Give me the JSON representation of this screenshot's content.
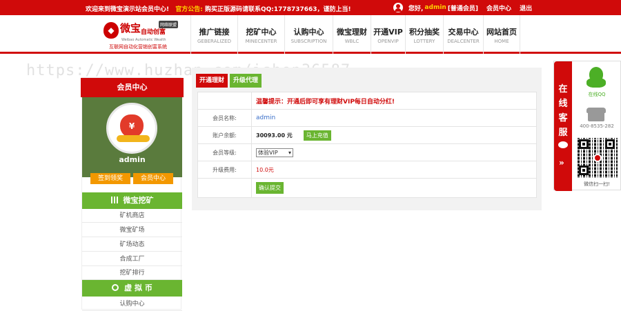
{
  "topbar": {
    "welcome": "欢迎来到微宝演示站会员中心!",
    "notice_label": "官方公告:",
    "notice_text": "购买正版源码请联系QQ:1778737663，谨防上当!",
    "greeting": "您好,",
    "username": "admin",
    "level": "[普通会员]",
    "member_center": "会员中心",
    "logout": "退出"
  },
  "logo": {
    "brand": "微宝",
    "brand_sub": "自动创富",
    "tag": "网络联盟",
    "english": "Weibao Automatic Wealth",
    "slogan": "互联网自动化营销创富系统"
  },
  "nav": [
    {
      "cn": "推广链接",
      "en": "GEBERALIZED"
    },
    {
      "cn": "挖矿中心",
      "en": "MINECENTER"
    },
    {
      "cn": "认购中心",
      "en": "SUBSCRIPTION"
    },
    {
      "cn": "微宝理财",
      "en": "WBLC"
    },
    {
      "cn": "开通VIP",
      "en": "OPENVIP"
    },
    {
      "cn": "积分抽奖",
      "en": "LOTTERY"
    },
    {
      "cn": "交易中心",
      "en": "DEALCENTER"
    },
    {
      "cn": "网站首页",
      "en": "HOME"
    }
  ],
  "watermark": "https://www.huzhan.com/ishop36587",
  "sidebar": {
    "title": "会员中心",
    "name": "admin",
    "sign_btn": "签到领奖",
    "member_btn": "会员中心",
    "section1": "微宝挖矿",
    "section1_items": [
      "矿机商店",
      "微宝矿场",
      "矿场动态",
      "合成工厂",
      "挖矿排行"
    ],
    "section2": "虚 拟 币",
    "section2_items": [
      "认购中心"
    ]
  },
  "panel": {
    "tab1": "开通理财",
    "tab2": "升级代理",
    "notice": "温馨提示：开通后即可享有理财VIP每日自动分红!",
    "username_label": "会员名称:",
    "username_value": "admin",
    "balance_label": "账户余额:",
    "balance_value": "30093.00 元",
    "recharge_btn": "马上充值",
    "level_label": "会员等级:",
    "level_value": "体验VIP",
    "fee_label": "升级费用:",
    "fee_value": "10.0元",
    "submit_btn": "确认提交"
  },
  "customer_service": {
    "vertical": [
      "在",
      "线",
      "客",
      "服"
    ],
    "qq_label": "在线QQ",
    "phone": "400-8535-282",
    "qr_label": "微信扫一扫!"
  }
}
